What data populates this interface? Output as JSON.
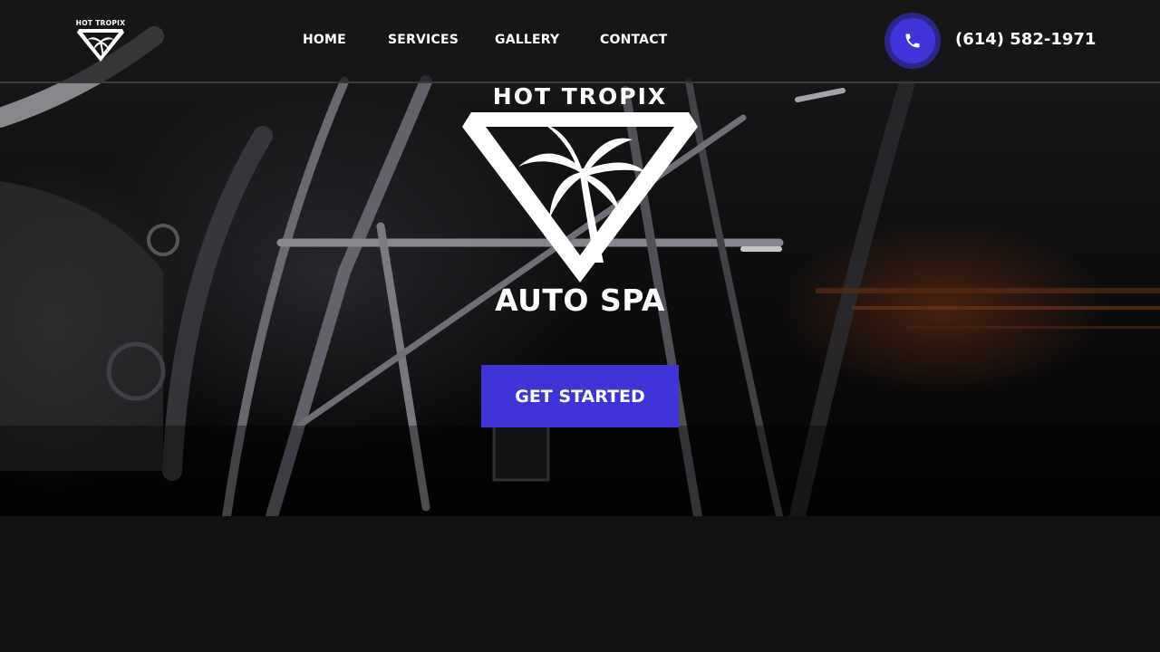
{
  "nav": {
    "logo_text": "HOT TROPIX",
    "items": [
      {
        "label": "HOME"
      },
      {
        "label": "SERVICES"
      },
      {
        "label": "GALLERY"
      },
      {
        "label": "CONTACT"
      }
    ],
    "phone_icon": "phone-icon",
    "phone": "(614) 582-1971"
  },
  "hero": {
    "brand_top": "HOT TROPIX",
    "brand_bottom": "AUTO SPA",
    "cta_label": "GET STARTED"
  },
  "colors": {
    "accent": "#3f34d8",
    "accent_dark": "#2b2687",
    "page_bg": "#111111",
    "text": "#ffffff"
  }
}
